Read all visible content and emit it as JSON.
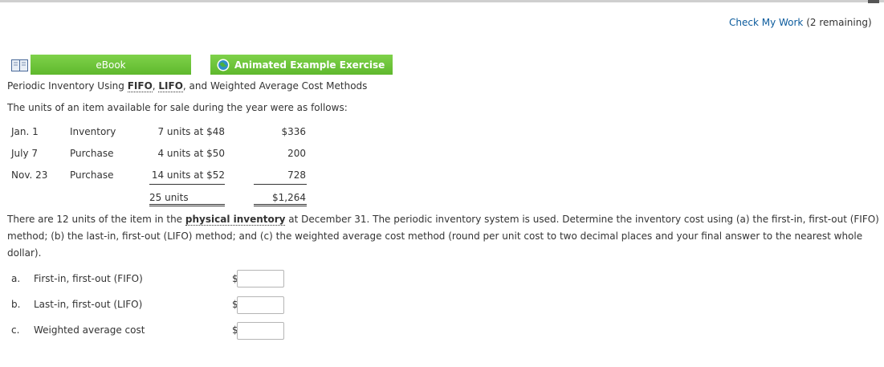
{
  "header": {
    "check_link_label": "Check My Work",
    "check_remaining": "(2 remaining)"
  },
  "toolbar": {
    "ebook_label": "eBook",
    "animated_label": "Animated Example Exercise"
  },
  "problem": {
    "title_prefix": "Periodic Inventory Using ",
    "fifo": "FIFO",
    "sep1": ", ",
    "lifo": "LIFO",
    "title_suffix": ", and Weighted Average Cost Methods",
    "intro": "The units of an item available for sale during the year were as follows:",
    "rows": [
      {
        "date": "Jan. 1",
        "type": "Inventory",
        "units": "7 units at $48",
        "cost": "$336"
      },
      {
        "date": "July 7",
        "type": "Purchase",
        "units": "4 units at $50",
        "cost": "200"
      },
      {
        "date": "Nov. 23",
        "type": "Purchase",
        "units": "14 units at $52",
        "cost": "728"
      }
    ],
    "total_units": "25 units",
    "total_cost": "$1,264",
    "para_part1": "There are 12 units of the item in the ",
    "para_link": "physical inventory",
    "para_part2": " at December 31. The periodic inventory system is used. Determine the inventory cost using (a) the first-in, first-out (FIFO) method; (b) the last-in, first-out (LIFO) method; and (c) the weighted average cost method (round per unit cost to two decimal places and your final answer to the nearest whole dollar)."
  },
  "answers": [
    {
      "letter": "a.",
      "label": "First-in, first-out (FIFO)",
      "currency": "$",
      "value": ""
    },
    {
      "letter": "b.",
      "label": "Last-in, first-out (LIFO)",
      "currency": "$",
      "value": ""
    },
    {
      "letter": "c.",
      "label": "Weighted average cost",
      "currency": "$",
      "value": ""
    }
  ],
  "colors": {
    "button_green": "#6cc43a",
    "link_blue": "#0a5a9c"
  }
}
